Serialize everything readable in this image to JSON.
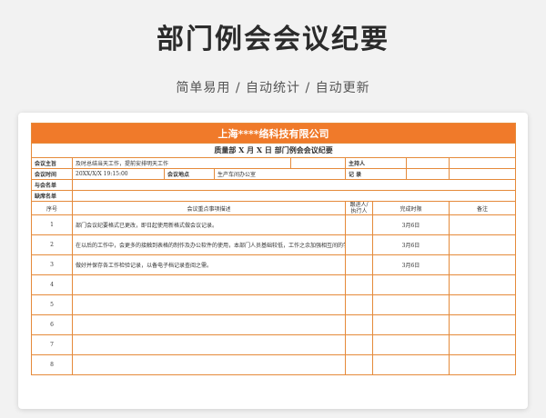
{
  "hero": {
    "title": "部门例会会议纪要",
    "subtitle": "简单易用  /  自动统计  /  自动更新"
  },
  "sheet": {
    "company": "上海****络科技有限公司",
    "subtitle": "质量部  X  月  X  日 部门例会会议纪要",
    "fields": {
      "meeting_host_label": "会议主旨",
      "meeting_host_value": "及时总结当天工作，提前安排明天工作",
      "host_person_label": "主持人",
      "meeting_time_label": "会议时间",
      "meeting_time_value": "20XX/X/X  19:15:00",
      "meeting_place_label": "会议地点",
      "meeting_place_value": "生产车间办公室",
      "record_label": "记  录",
      "attendees_label": "与会名单",
      "absent_label": "缺席名单"
    },
    "columns": {
      "no": "序号",
      "content": "会议重点事项描述",
      "follower": "跟进人/执行人",
      "deadline": "完成时限",
      "remark": "备注"
    },
    "rows": [
      {
        "no": "1",
        "content": "部门会议纪要格式已更改，即日起使用新格式做会议记录。",
        "follower": "",
        "deadline": "3月6日",
        "remark": ""
      },
      {
        "no": "2",
        "content": "在以后的工作中，会更多的接触到表格的制作及办公软件的使用，本部门人员基础较低，工作之余加强相互间的学习。",
        "follower": "",
        "deadline": "3月6日",
        "remark": ""
      },
      {
        "no": "3",
        "content": "做好并保存各工作检验记录，以备电子档记录查阅之需。",
        "follower": "",
        "deadline": "3月6日",
        "remark": ""
      },
      {
        "no": "4",
        "content": "",
        "follower": "",
        "deadline": "",
        "remark": ""
      },
      {
        "no": "5",
        "content": "",
        "follower": "",
        "deadline": "",
        "remark": ""
      },
      {
        "no": "6",
        "content": "",
        "follower": "",
        "deadline": "",
        "remark": ""
      },
      {
        "no": "7",
        "content": "",
        "follower": "",
        "deadline": "",
        "remark": ""
      },
      {
        "no": "8",
        "content": "",
        "follower": "",
        "deadline": "",
        "remark": ""
      }
    ]
  }
}
